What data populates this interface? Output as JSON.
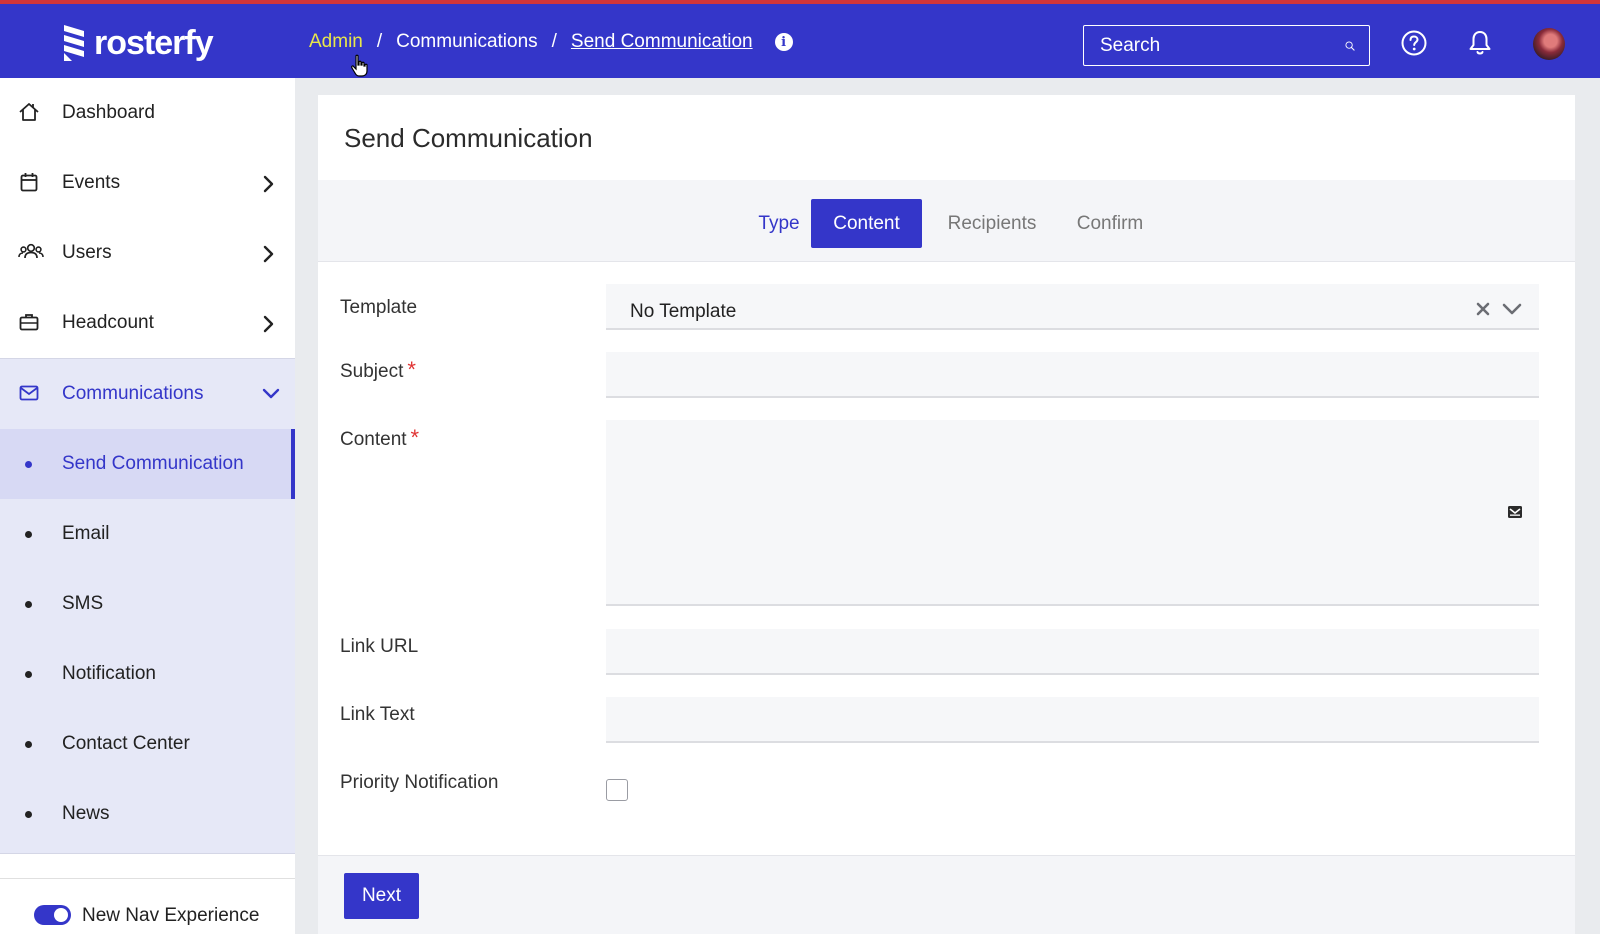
{
  "app": {
    "name": "rosterfy"
  },
  "breadcrumb": {
    "items": [
      "Admin",
      "Communications",
      "Send Communication"
    ],
    "separator": "/"
  },
  "search": {
    "placeholder": "Search",
    "value": ""
  },
  "sidebar": {
    "items": [
      {
        "label": "Dashboard",
        "icon": "home-icon"
      },
      {
        "label": "Events",
        "icon": "calendar-icon"
      },
      {
        "label": "Users",
        "icon": "users-icon"
      },
      {
        "label": "Headcount",
        "icon": "briefcase-icon"
      },
      {
        "label": "Communications",
        "icon": "mail-icon"
      }
    ],
    "sub_items": [
      {
        "label": "Send Communication",
        "active": true
      },
      {
        "label": "Email"
      },
      {
        "label": "SMS"
      },
      {
        "label": "Notification"
      },
      {
        "label": "Contact Center"
      },
      {
        "label": "News"
      }
    ],
    "toggle": {
      "label": "New Nav Experience",
      "on": true
    }
  },
  "page": {
    "title": "Send Communication",
    "steps": [
      {
        "label": "Type",
        "state": "done"
      },
      {
        "label": "Content",
        "state": "active"
      },
      {
        "label": "Recipients",
        "state": "pending"
      },
      {
        "label": "Confirm",
        "state": "pending"
      }
    ],
    "form": {
      "template": {
        "label": "Template",
        "value": "No Template"
      },
      "subject": {
        "label": "Subject",
        "required_mark": "*",
        "value": ""
      },
      "content": {
        "label": "Content",
        "required_mark": "*",
        "value": ""
      },
      "link_url": {
        "label": "Link URL",
        "value": ""
      },
      "link_text": {
        "label": "Link Text",
        "value": ""
      },
      "priority": {
        "label": "Priority Notification",
        "checked": false
      }
    },
    "next_label": "Next"
  },
  "colors": {
    "brand": "#3436c9",
    "highlight": "#e9e74a",
    "required": "#e03333",
    "active_bg": "#d7d9f4"
  }
}
